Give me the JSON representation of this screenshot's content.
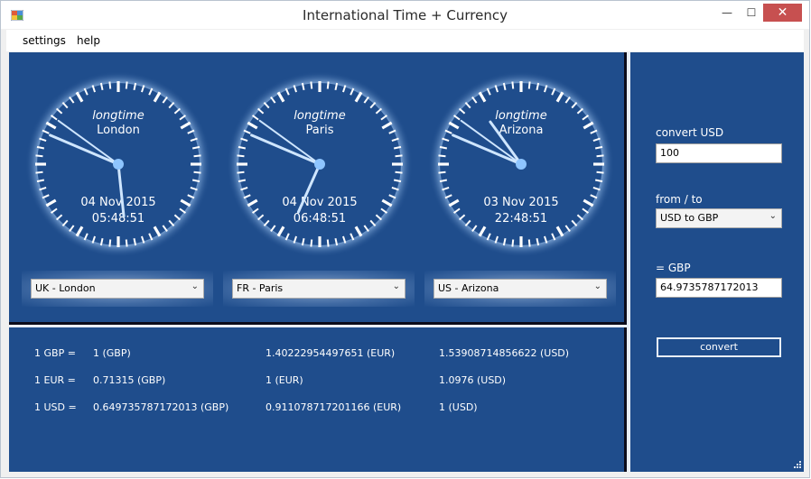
{
  "window": {
    "title": "International Time + Currency",
    "minimize_glyph": "—",
    "maximize_glyph": "☐",
    "close_glyph": "✕"
  },
  "menu": {
    "settings": "settings",
    "help": "help"
  },
  "clocks": [
    {
      "label": "longtime",
      "city": "London",
      "date": "04 Nov 2015",
      "time": "05:48:51",
      "hour": 5,
      "minute": 48,
      "second": 51,
      "select": "UK - London"
    },
    {
      "label": "longtime",
      "city": "Paris",
      "date": "04 Nov 2015",
      "time": "06:48:51",
      "hour": 6,
      "minute": 48,
      "second": 51,
      "select": "FR - Paris"
    },
    {
      "label": "longtime",
      "city": "Arizona",
      "date": "03 Nov 2015",
      "time": "22:48:51",
      "hour": 22,
      "minute": 48,
      "second": 51,
      "select": "US - Arizona"
    }
  ],
  "rates": {
    "rows": [
      {
        "label": "1 GBP =",
        "gbp": "1 (GBP)",
        "eur": "1.40222954497651 (EUR)",
        "usd": "1.53908714856622 (USD)"
      },
      {
        "label": "1 EUR =",
        "gbp": "0.71315 (GBP)",
        "eur": "1 (EUR)",
        "usd": "1.0976 (USD)"
      },
      {
        "label": "1 USD =",
        "gbp": "0.649735787172013 (GBP)",
        "eur": "0.911078717201166 (EUR)",
        "usd": "1 (USD)"
      }
    ]
  },
  "converter": {
    "amount_label": "convert USD",
    "amount_value": "100",
    "direction_label": "from / to",
    "direction_value": "USD to GBP",
    "result_label": "= GBP",
    "result_value": "64.9735787172013",
    "button_label": "convert"
  },
  "colors": {
    "panel": "#1f4d8c",
    "clock_face": "#1f4d8c",
    "hand": "#cfe6ff",
    "hub": "#8ec5ff"
  },
  "icons": {
    "chevron": "⌄"
  }
}
